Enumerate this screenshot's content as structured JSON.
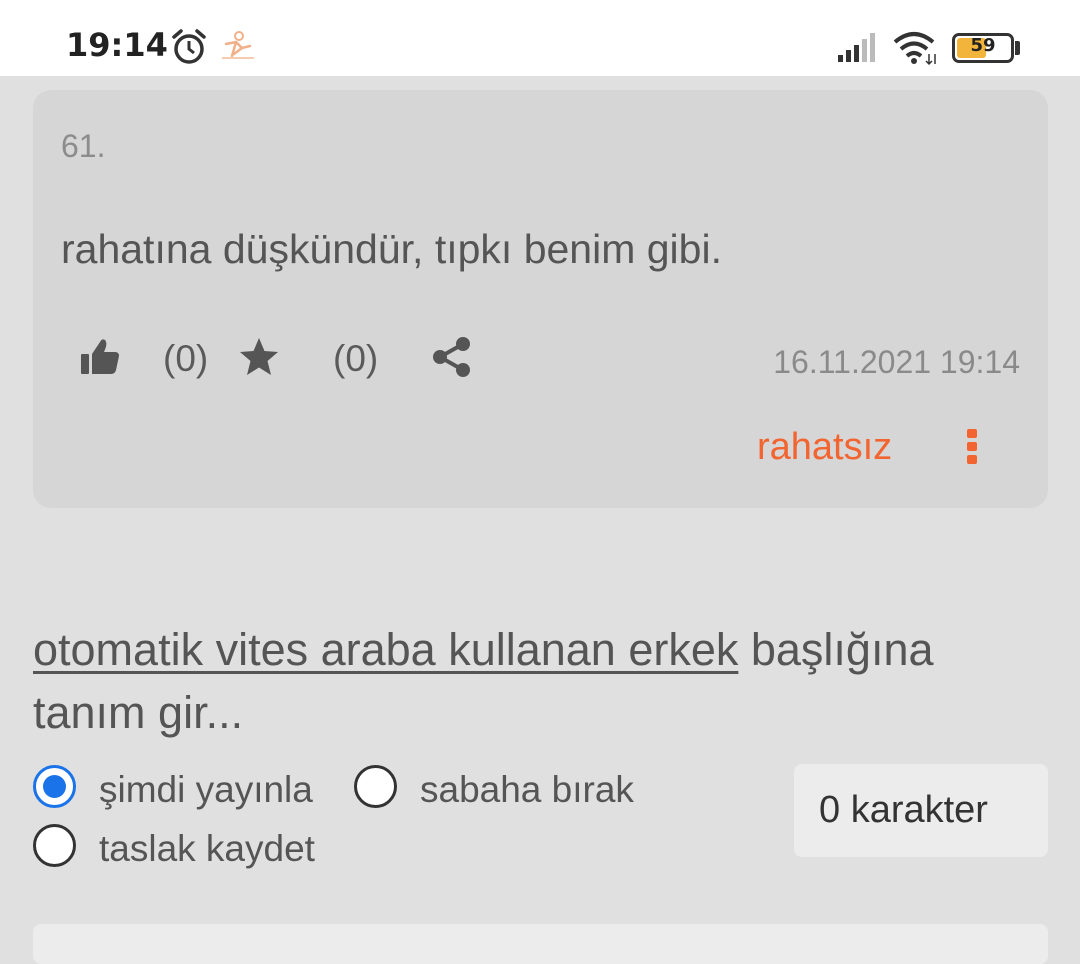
{
  "status_bar": {
    "time": "19:14",
    "battery_level": 59,
    "battery_text": "59",
    "icons": [
      "alarm-clock-icon",
      "app-notification-icon",
      "signal-icon",
      "wifi-icon",
      "battery-icon"
    ]
  },
  "entry": {
    "number": "61.",
    "text": "rahatına düşkündür, tıpkı benim gibi.",
    "like_count": "(0)",
    "favorite_count": "(0)",
    "date": "16.11.2021 19:14",
    "author": "rahatsız"
  },
  "compose": {
    "topic_link": "otomatik vites araba kullanan erkek",
    "prompt_suffix": " başlığına tanım gir...",
    "options": [
      {
        "label": "şimdi yayınla",
        "checked": true
      },
      {
        "label": "sabaha bırak",
        "checked": false
      },
      {
        "label": "taslak kaydet",
        "checked": false
      }
    ],
    "char_count": "0 karakter"
  },
  "colors": {
    "accent": "#f26430",
    "radio_checked": "#1a73e8",
    "card_bg": "#d6d6d6",
    "page_bg": "#e0e0e0"
  }
}
